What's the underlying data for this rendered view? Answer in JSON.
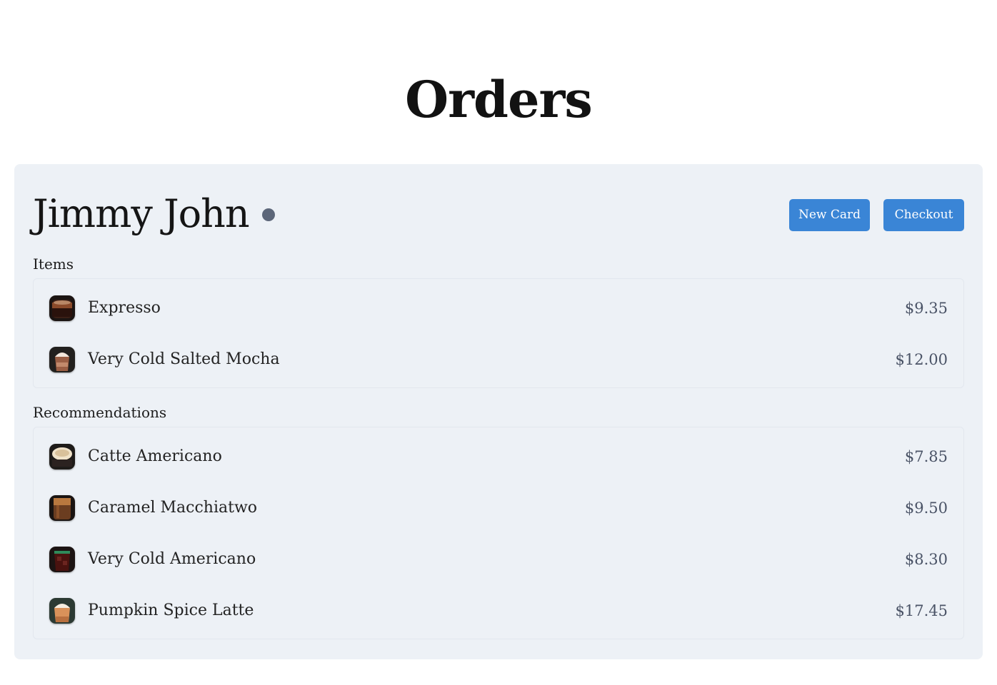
{
  "page": {
    "title": "Orders"
  },
  "order": {
    "customer_name": "Jimmy John",
    "actions": {
      "new_card": "New Card",
      "checkout": "Checkout"
    },
    "items_label": "Items",
    "items": [
      {
        "name": "Expresso",
        "price": "$9.35",
        "icon": "espresso-cup-icon"
      },
      {
        "name": "Very Cold Salted Mocha",
        "price": "$12.00",
        "icon": "iced-mocha-icon"
      }
    ],
    "recommendations_label": "Recommendations",
    "recommendations": [
      {
        "name": "Catte Americano",
        "price": "$7.85",
        "icon": "latte-cup-icon"
      },
      {
        "name": "Caramel Macchiatwo",
        "price": "$9.50",
        "icon": "macchiato-cup-icon"
      },
      {
        "name": "Very Cold Americano",
        "price": "$8.30",
        "icon": "iced-americano-icon"
      },
      {
        "name": "Pumpkin Spice Latte",
        "price": "$17.45",
        "icon": "pumpkin-latte-icon"
      }
    ]
  },
  "colors": {
    "accent": "#3a85d6",
    "card_background": "#edf1f6",
    "status_dot": "#5c6679"
  }
}
